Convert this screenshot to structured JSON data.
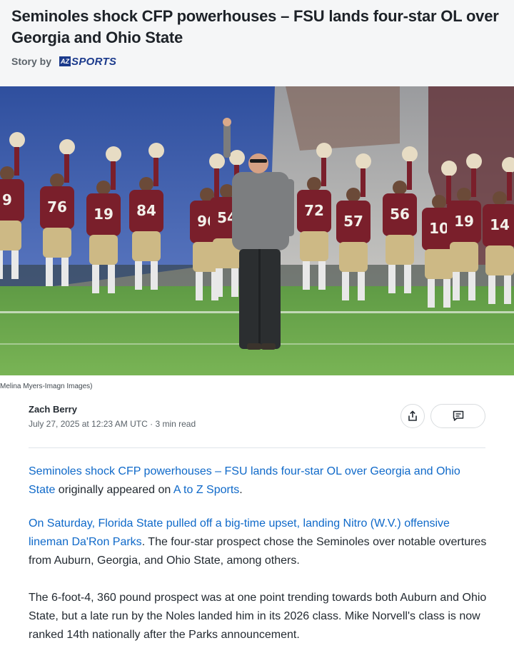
{
  "article": {
    "headline": "Seminoles shock CFP powerhouses – FSU lands four-star OL over Georgia and Ohio State",
    "story_by_label": "Story by",
    "source_logo_mark": "AZ",
    "source_logo_text": "SPORTS"
  },
  "photo": {
    "jersey_numbers": [
      "9",
      "76",
      "19",
      "84",
      "96",
      "54",
      "72",
      "57",
      "56",
      "10",
      "19",
      "14"
    ],
    "caption": "Melina Myers-Imagn Images)"
  },
  "byline": {
    "author": "Zach Berry",
    "date": "July 27, 2025 at 12:23 AM UTC",
    "separator": "·",
    "read_time": "3 min read"
  },
  "actions": {
    "share_icon": "share-icon",
    "comment_icon": "comment-icon"
  },
  "body": {
    "p1_link": "Seminoles shock CFP powerhouses – FSU lands four-star OL over Georgia and Ohio State",
    "p1_text": " originally appeared on ",
    "p1_source_link": "A to Z Sports",
    "p1_end": ".",
    "p2_link": "On Saturday, Florida State pulled off a big-time upset, landing Nitro (W.V.) offensive lineman Da'Ron Parks",
    "p2_text": ". The four-star prospect chose the Seminoles over notable overtures from Auburn, Georgia, and Ohio State, among others.",
    "p3_text": "The 6-foot-4, 360 pound prospect was at one point trending towards both Auburn and Ohio State, but a late run by the Noles landed him in its 2026 class. Mike Norvell's class is now ranked 14th nationally after the Parks announcement."
  },
  "colors": {
    "link": "#0f69c9",
    "brand": "#1b3a8c",
    "jersey": "#7a1f2b",
    "pants": "#cdb985",
    "field": "#6aa64d"
  }
}
